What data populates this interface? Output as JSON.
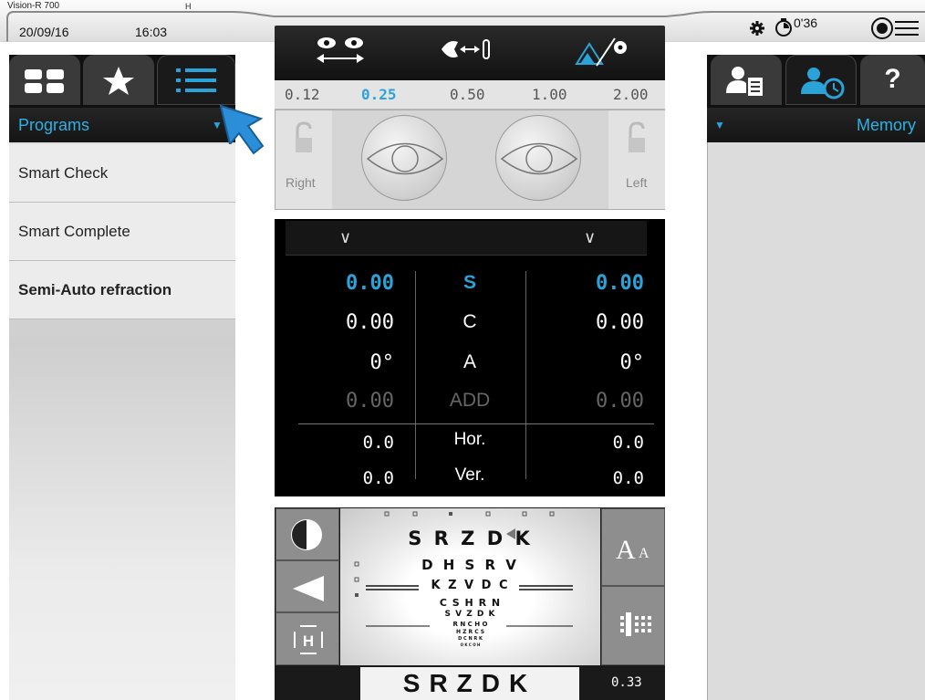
{
  "status": {
    "model": "Vision-R 700",
    "flag": "H",
    "date": "20/09/16",
    "time": "16:03",
    "timer": "0'36"
  },
  "left_panel": {
    "tabs": [
      "grid-tab",
      "favorites-tab",
      "list-tab"
    ],
    "header": "Programs",
    "items": [
      {
        "label": "Smart Check"
      },
      {
        "label": "Smart Complete"
      },
      {
        "label": "Semi-Auto refraction"
      }
    ]
  },
  "right_panel": {
    "header": "Memory",
    "tabs": [
      "patient-record-tab",
      "patient-history-tab",
      "help-tab"
    ],
    "help_label": "?"
  },
  "acuity": {
    "values": [
      "0.12",
      "0.25",
      "0.50",
      "1.00",
      "2.00"
    ],
    "selected": "0.25"
  },
  "eyes": {
    "right_label": "Right",
    "left_label": "Left"
  },
  "refraction": {
    "rows": [
      {
        "right": "0.00",
        "label": "S",
        "left": "0.00"
      },
      {
        "right": "0.00",
        "label": "C",
        "left": "0.00"
      },
      {
        "right": "0°",
        "label": "A",
        "left": "0°"
      },
      {
        "right": "0.00",
        "label": "ADD",
        "left": "0.00"
      }
    ],
    "prism_rows": [
      {
        "right": "0.0",
        "label": "Hor.",
        "left": "0.0"
      },
      {
        "right": "0.0",
        "label": "Ver.",
        "left": "0.0"
      }
    ]
  },
  "chart": {
    "lines": [
      "S R Z D K",
      "D H S R V",
      "K Z V D C",
      "C S H R N",
      "S V Z D K",
      "R N C H O",
      "H Z R C S",
      "D C N R K",
      "O K C O H"
    ],
    "current_line": "SRZDK",
    "acuity": "0.33",
    "font_toggle": "A",
    "font_toggle_small": "A"
  },
  "colors": {
    "accent": "#2ba3d8",
    "dark": "#111111"
  }
}
